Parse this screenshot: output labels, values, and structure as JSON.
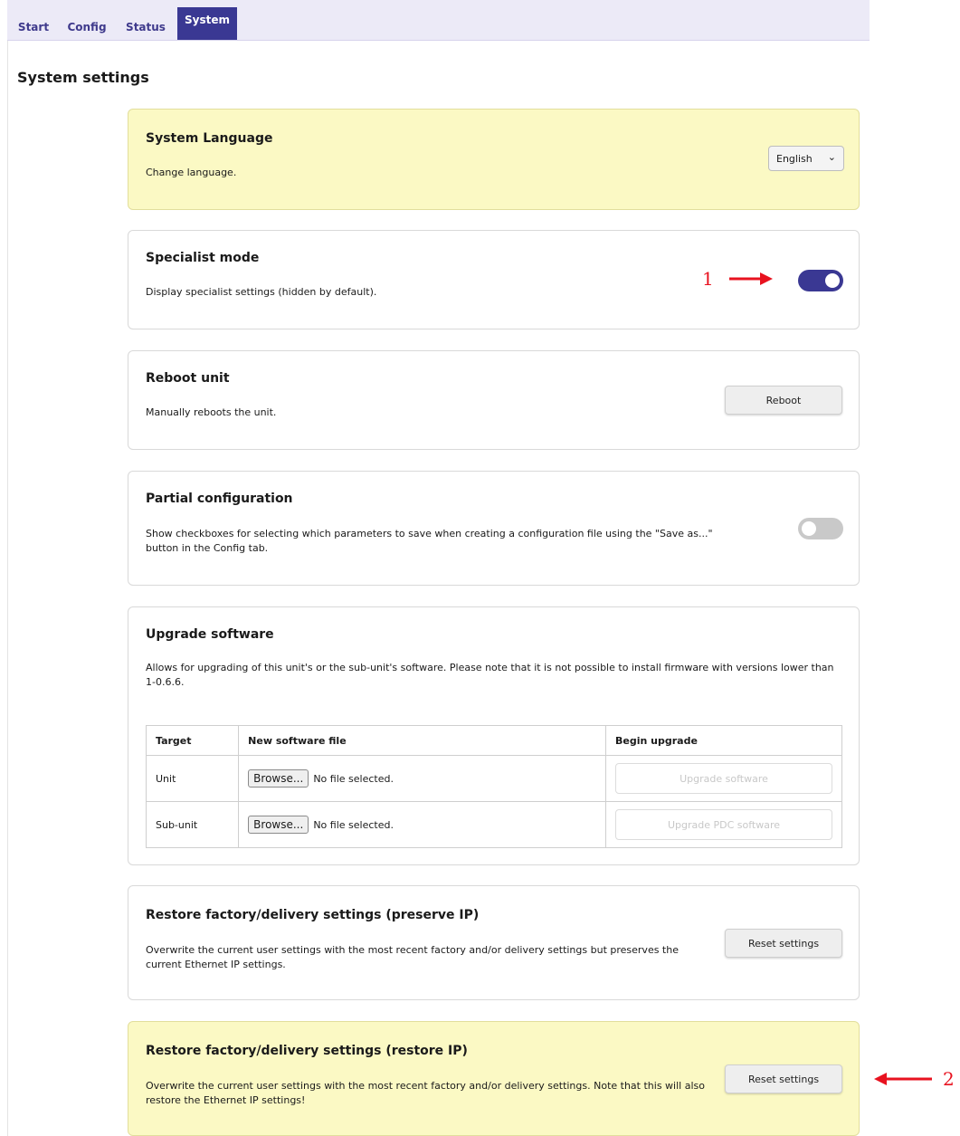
{
  "tabs": [
    {
      "label": "Start",
      "active": false
    },
    {
      "label": "Config",
      "active": false
    },
    {
      "label": "Status",
      "active": false
    },
    {
      "label": "System",
      "active": true
    }
  ],
  "page_title": "System settings",
  "language": {
    "title": "System Language",
    "description": "Change language.",
    "selected": "English"
  },
  "specialist": {
    "title": "Specialist mode",
    "description": "Display specialist settings (hidden by default).",
    "enabled": true
  },
  "reboot": {
    "title": "Reboot unit",
    "description": "Manually reboots the unit.",
    "button": "Reboot"
  },
  "partial": {
    "title": "Partial configuration",
    "description": "Show checkboxes for selecting which parameters to save when creating a configuration file using the \"Save as...\" button in the Config tab.",
    "enabled": false
  },
  "upgrade": {
    "title": "Upgrade software",
    "description": "Allows for upgrading of this unit's or the sub-unit's software. Please note that it is not possible to install firmware with versions lower than 1-0.6.6.",
    "headers": [
      "Target",
      "New software file",
      "Begin upgrade"
    ],
    "rows": [
      {
        "target": "Unit",
        "browse": "Browse...",
        "file": "No file selected.",
        "button": "Upgrade software"
      },
      {
        "target": "Sub-unit",
        "browse": "Browse...",
        "file": "No file selected.",
        "button": "Upgrade PDC software"
      }
    ]
  },
  "restore_preserve": {
    "title": "Restore factory/delivery settings (preserve IP)",
    "description": "Overwrite the current user settings with the most recent factory and/or delivery settings but preserves the current Ethernet IP settings.",
    "button": "Reset settings"
  },
  "restore_ip": {
    "title": "Restore factory/delivery settings (restore IP)",
    "description": "Overwrite the current user settings with the most recent factory and/or delivery settings. Note that this will also restore the Ethernet IP settings!",
    "button": "Reset settings"
  },
  "annotations": {
    "one": "1",
    "two": "2"
  },
  "colors": {
    "accent": "#3a3893",
    "highlight": "#fbf9c4",
    "annotation": "#e8121f"
  }
}
